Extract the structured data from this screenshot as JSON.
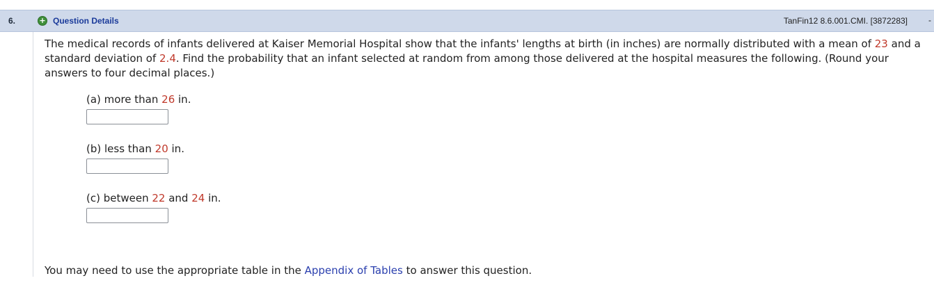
{
  "header": {
    "question_number": "6.",
    "expand_glyph": "+",
    "details_link": "Question Details",
    "question_id": "TanFin12 8.6.001.CMI. [3872283]",
    "trailing_mark": "-"
  },
  "problem": {
    "t1": "The medical records of infants delivered at Kaiser Memorial Hospital show that the infants' lengths at birth (in inches) are normally distributed with a mean of ",
    "mean": "23",
    "t2": " and a standard deviation of ",
    "sd": "2.4",
    "t3": ". Find the probability that an infant selected at random from among those delivered at the hospital measures the following. (Round your answers to four decimal places.)"
  },
  "parts": {
    "a": {
      "prefix": "(a) more than ",
      "value": "26",
      "suffix": " in."
    },
    "b": {
      "prefix": "(b) less than ",
      "value": "20",
      "suffix": " in."
    },
    "c": {
      "prefix": "(c) between ",
      "value1": "22",
      "middle": " and ",
      "value2": "24",
      "suffix": " in."
    }
  },
  "footer": {
    "before": "You may need to use the appropriate table in the ",
    "link": "Appendix of Tables",
    "after": " to answer this question."
  },
  "icons": {
    "expand": "plus-circle-icon"
  },
  "colors": {
    "header_bg": "#cfd9ea",
    "link": "#1a3a9a",
    "number_highlight": "#c0392b",
    "expand_icon": "#3f8f3a"
  }
}
